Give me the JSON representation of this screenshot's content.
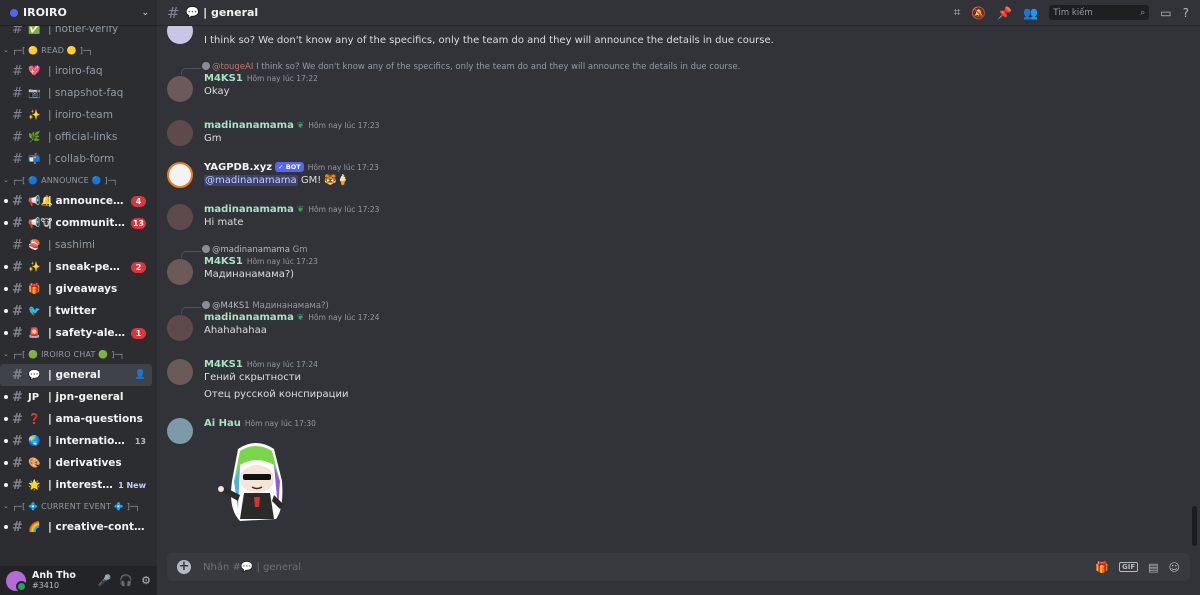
{
  "server": {
    "name": "IROIRO"
  },
  "sidebar": {
    "rows": [
      {
        "kind": "channel",
        "emoji": "✅",
        "label": "| hotler-verify",
        "unread": false
      },
      {
        "kind": "category",
        "label": "┌─[ 🟡 READ 🟡 ]─┐"
      },
      {
        "kind": "channel",
        "emoji": "💖",
        "label": "| iroiro-faq"
      },
      {
        "kind": "channel",
        "emoji": "📷",
        "label": "| snapshot-faq"
      },
      {
        "kind": "channel",
        "emoji": "✨",
        "label": "| iroiro-team"
      },
      {
        "kind": "channel",
        "emoji": "🌿",
        "label": "| official-links"
      },
      {
        "kind": "channel",
        "emoji": "📬",
        "label": "| collab-form"
      },
      {
        "kind": "category",
        "label": "┌─[ 🔵 ANNOUNCE 🔵 ]─┐"
      },
      {
        "kind": "channel",
        "emoji": "📢🔔",
        "label": "| announcement",
        "unread": true,
        "badge": "4"
      },
      {
        "kind": "channel",
        "emoji": "📢🐮",
        "label": "| community-a...",
        "unread": true,
        "badge": "13"
      },
      {
        "kind": "channel",
        "emoji": "🍣",
        "label": "| sashimi"
      },
      {
        "kind": "channel",
        "emoji": "✨",
        "label": "| sneak-peeks",
        "unread": true,
        "badge": "2"
      },
      {
        "kind": "channel",
        "emoji": "🎁",
        "label": "| giveaways",
        "unread": true
      },
      {
        "kind": "channel",
        "emoji": "🐦",
        "label": "| twitter",
        "unread": true
      },
      {
        "kind": "channel",
        "emoji": "🚨",
        "label": "| safety-alerts",
        "unread": true,
        "badge": "1"
      },
      {
        "kind": "category",
        "label": "┌─[ 🟢 IROIRO CHAT 🟢 ]─┐"
      },
      {
        "kind": "channel",
        "emoji": "💬",
        "label": "| general",
        "active": true
      },
      {
        "kind": "channel",
        "emoji": "JP",
        "label": "| jpn-general",
        "unread": true
      },
      {
        "kind": "channel",
        "emoji": "❓",
        "label": "| ama-questions",
        "unread": true
      },
      {
        "kind": "channel",
        "emoji": "🌏",
        "label": "| international-c...",
        "unread": true,
        "count": "13"
      },
      {
        "kind": "channel",
        "emoji": "🎨",
        "label": "| derivatives",
        "unread": true
      },
      {
        "kind": "channel",
        "emoji": "🌟",
        "label": "| interests-sh...",
        "unread": true,
        "newtag": "1 New"
      },
      {
        "kind": "category",
        "label": "┌─[ 💠 CURRENT EVENT 💠 ]─┐"
      },
      {
        "kind": "channel",
        "emoji": "🌈",
        "label": "| creative-contest",
        "unread": true
      }
    ]
  },
  "user": {
    "name": "Anh Tho",
    "tag": "#3410"
  },
  "topbar": {
    "channel": "💬 | general",
    "search_placeholder": "Tìm kiếm"
  },
  "messages": {
    "partial": {
      "text": "I think so? We don't know any of the specifics, only the team do and they will announce the details in due course."
    },
    "m1": {
      "reply_name": "@tougeAI",
      "reply_text": "I think so? We don't know any of the specifics, only the team do and they will announce the details in due course.",
      "author": "M4KS1",
      "time": "Hôm nay lúc 17:22",
      "text": "Okay"
    },
    "m2": {
      "author": "madinanamama",
      "time": "Hôm nay lúc 17:23",
      "text": "Gm"
    },
    "m3": {
      "author": "YAGPDB.xyz",
      "bot_label": "✓ BOT",
      "time": "Hôm nay lúc 17:23",
      "mention": "@madinanamama",
      "text": "GM! 🐯🍦"
    },
    "m4": {
      "author": "madinanamama",
      "time": "Hôm nay lúc 17:23",
      "text": "Hi mate"
    },
    "m5": {
      "reply_name": "@madinanamama",
      "reply_text": "Gm",
      "author": "M4KS1",
      "time": "Hôm nay lúc 17:23",
      "text": "Мадинанамама?)"
    },
    "m6": {
      "reply_name": "@M4KS1",
      "reply_text": "Мадинанамама?)",
      "author": "madinanamama",
      "time": "Hôm nay lúc 17:24",
      "text": "Ahahahahaa"
    },
    "m7": {
      "author": "M4KS1",
      "time": "Hôm nay lúc 17:24",
      "line1": "Гений скрытности",
      "line2": "Отец русской конспирации"
    },
    "m8": {
      "author": "Ai Hau",
      "time": "Hôm nay lúc 17:30"
    }
  },
  "composer": {
    "placeholder": "Nhắn #💬 | general"
  },
  "colors": {
    "accent": "#5865f2",
    "username": "#a7e3c3",
    "badge": "#da373c"
  }
}
